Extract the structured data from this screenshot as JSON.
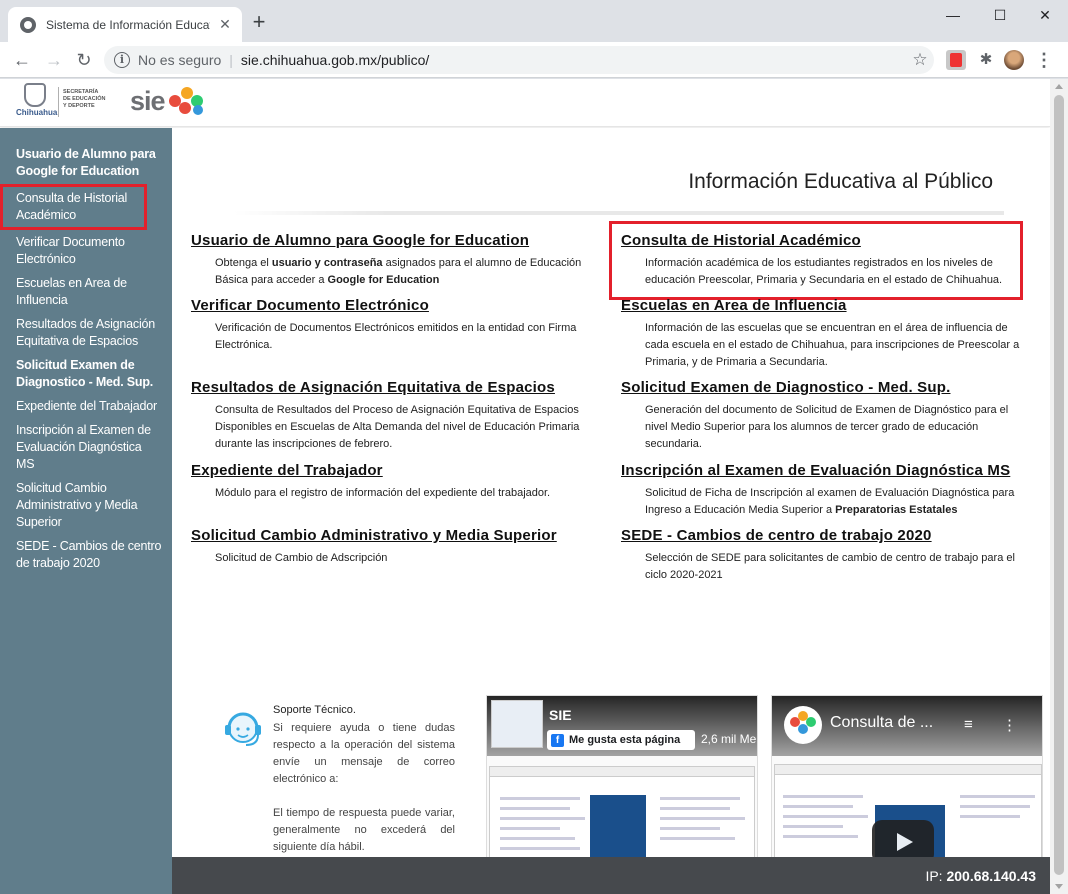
{
  "browser": {
    "tab_title": "Sistema de Información Educativa",
    "insecure_label": "No es seguro",
    "url": "sie.chihuahua.gob.mx/publico/"
  },
  "header": {
    "state_logo_text": "Chihuahua",
    "secretaria_lines": [
      "SECRETARÍA",
      "DE EDUCACIÓN",
      "Y DEPORTE"
    ],
    "sie_logo_text": "sie"
  },
  "sidebar": {
    "items": [
      {
        "label": "Usuario de Alumno para Google for Education",
        "bold": true
      },
      {
        "label": "Consulta de Historial Académico",
        "bold": false
      },
      {
        "label": "Verificar Documento Electrónico",
        "bold": false
      },
      {
        "label": "Escuelas en Area de Influencia",
        "bold": false
      },
      {
        "label": "Resultados de Asignación Equitativa de Espacios",
        "bold": false
      },
      {
        "label": "Solicitud Examen de Diagnostico - Med. Sup.",
        "bold": true
      },
      {
        "label": "Expediente del Trabajador",
        "bold": false
      },
      {
        "label": "Inscripción al Examen de Evaluación Diagnóstica MS",
        "bold": false
      },
      {
        "label": "Solicitud Cambio Administrativo y Media Superior",
        "bold": false
      },
      {
        "label": "SEDE - Cambios de centro de trabajo 2020",
        "bold": false
      }
    ]
  },
  "main": {
    "title": "Información Educativa al Público",
    "cards": [
      {
        "title": "Usuario de Alumno para Google for Education",
        "desc_pre": "Obtenga el ",
        "desc_b1": "usuario y contraseña",
        "desc_mid": " asignados para el alumno de Educación Básica para acceder a ",
        "desc_b2": "Google for Education",
        "desc_post": ""
      },
      {
        "title": "Consulta de Historial Académico",
        "desc": "Información académica de los estudiantes registrados en los niveles de educación Preescolar, Primaria y Secundaria en el estado de Chihuahua."
      },
      {
        "title": "Verificar Documento Electrónico",
        "desc": "Verificación de Documentos Electrónicos emitidos en la entidad con Firma Electrónica."
      },
      {
        "title": "Escuelas en Area de Influencia",
        "desc": "Información de las escuelas que se encuentran en el área de influencia de cada escuela en el estado de Chihuahua, para inscripciones de Preescolar a Primaria, y de Primaria a Secundaria."
      },
      {
        "title": "Resultados de Asignación Equitativa de Espacios",
        "desc": "Consulta de Resultados del Proceso de Asignación Equitativa de Espacios Disponibles en Escuelas de Alta Demanda del nivel de Educación Primaria durante las inscripciones de febrero."
      },
      {
        "title": "Solicitud Examen de Diagnostico - Med. Sup.",
        "desc": "Generación del documento de Solicitud de Examen de Diagnóstico para el nivel Medio Superior para los alumnos de tercer grado de educación secundaria."
      },
      {
        "title": "Expediente del Trabajador",
        "desc": "Módulo para el registro de información del expediente del trabajador."
      },
      {
        "title": "Inscripción al Examen de Evaluación Diagnóstica MS",
        "desc_pre": "Solicitud de Ficha de Inscripción al examen de Evaluación Diagnóstica para Ingreso a Educación Media Superior a ",
        "desc_b1": "Preparatorias Estatales"
      },
      {
        "title": "Solicitud Cambio Administrativo y Media Superior",
        "desc": "Solicitud de Cambio de Adscripción"
      },
      {
        "title": "SEDE - Cambios de centro de trabajo 2020",
        "desc": "Selección de SEDE para solicitantes de cambio de centro de trabajo para el ciclo 2020-2021"
      }
    ]
  },
  "support": {
    "title": "Soporte Técnico.",
    "p1": "Si requiere ayuda o tiene dudas respecto a la operación del sistema envíe un mensaje de correo electrónico a:",
    "p2": "El tiempo de respuesta puede variar, generalmente no excederá del siguiente día hábil."
  },
  "video1": {
    "title": "SIE",
    "like_label": "Me gusta esta página",
    "like_count": "2,6 mil Me"
  },
  "video2": {
    "title": "Consulta de ..."
  },
  "footer": {
    "ip_label": "IP:",
    "ip_value": "200.68.140.43"
  },
  "colors": {
    "sidebar_bg": "#607d8b",
    "highlight_red": "#e3202b",
    "footer_bg": "#46494d"
  }
}
